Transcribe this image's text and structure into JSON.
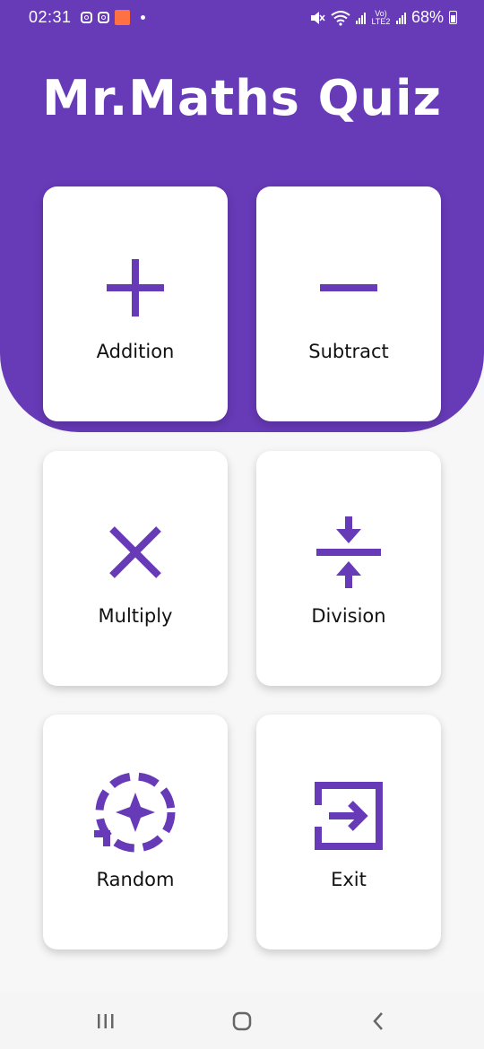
{
  "status_bar": {
    "time": "02:31",
    "lte": "Vo) LTE2",
    "battery": "68%",
    "icons": [
      "instagram-icon",
      "instagram-icon",
      "app-notification-icon",
      "dot-icon",
      "mute-icon",
      "wifi-icon",
      "signal-icon",
      "signal-icon",
      "battery-icon"
    ]
  },
  "header": {
    "title": "Mr.Maths Quiz"
  },
  "theme": {
    "accent": "#673ab7",
    "card_bg": "#ffffff",
    "page_bg": "#f7f7f7"
  },
  "cards": [
    {
      "label": "Addition",
      "icon": "plus-icon"
    },
    {
      "label": "Subtract",
      "icon": "minus-icon"
    },
    {
      "label": "Multiply",
      "icon": "multiply-icon"
    },
    {
      "label": "Division",
      "icon": "division-icon"
    },
    {
      "label": "Random",
      "icon": "random-icon"
    },
    {
      "label": "Exit",
      "icon": "exit-icon"
    }
  ],
  "nav_bar": {
    "items": [
      "recent-apps-icon",
      "home-icon",
      "back-icon"
    ]
  }
}
